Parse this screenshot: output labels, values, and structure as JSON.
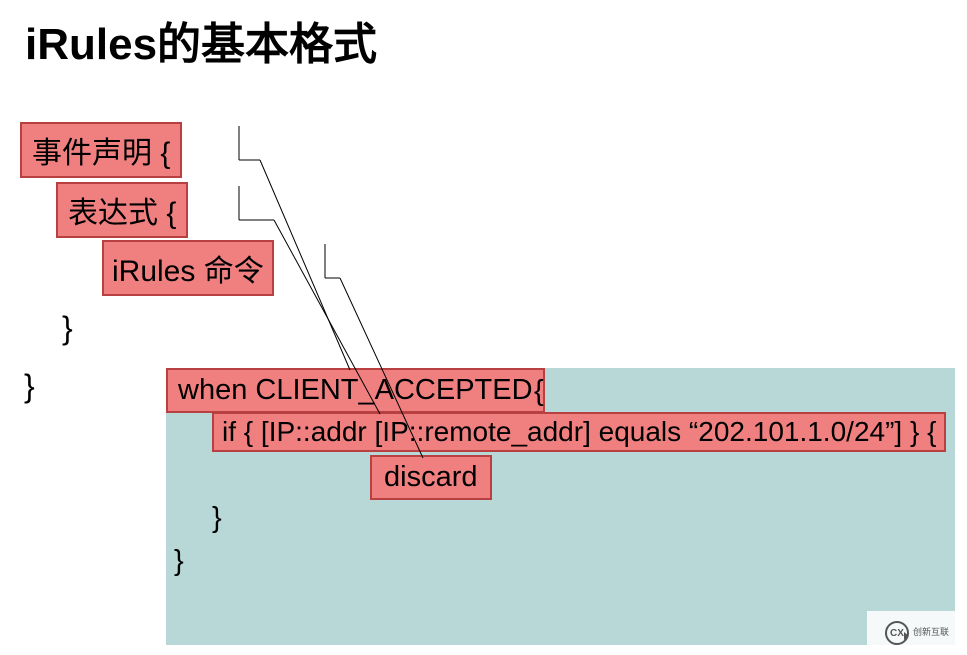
{
  "title": "iRules的基本格式",
  "structure": {
    "event_label": "事件声明 {",
    "expression_label": "表达式 {",
    "command_label": "iRules 命令",
    "close1": "}",
    "close2": "}"
  },
  "code": {
    "when_clause": "when CLIENT_ACCEPTED",
    "when_brace": "{",
    "if_clause": "if { [IP::addr [IP::remote_addr] equals “202.101.1.0/24”] } {",
    "discard": "discard",
    "close_if": "}",
    "close_when": "}"
  },
  "watermark": {
    "icon_text": "CX",
    "text": "创新互联"
  },
  "diagram_mapping": [
    {
      "from": "事件声明",
      "to": "when CLIENT_ACCEPTED"
    },
    {
      "from": "表达式",
      "to": "if { [IP::addr [IP::remote_addr] equals “202.101.1.0/24”] } {"
    },
    {
      "from": "iRules 命令",
      "to": "discard"
    }
  ]
}
